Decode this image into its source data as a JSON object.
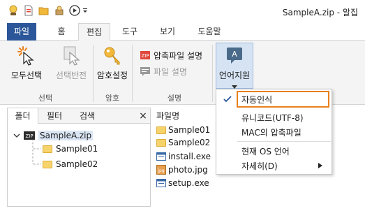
{
  "window": {
    "title": "SampleA.zip - 알집"
  },
  "quick_access": [
    "app-logo-icon",
    "new-icon",
    "open-icon",
    "extract-icon",
    "play-icon",
    "dropdown-arrow-icon"
  ],
  "menu": {
    "tabs": [
      {
        "label": "파일",
        "active": false,
        "file": true
      },
      {
        "label": "홈",
        "active": false
      },
      {
        "label": "편집",
        "active": true
      },
      {
        "label": "도구",
        "active": false
      },
      {
        "label": "보기",
        "active": false
      },
      {
        "label": "도움말",
        "active": false
      }
    ]
  },
  "ribbon": {
    "select_all": "모두선택",
    "invert_select": "선택반전",
    "group_select": "선택",
    "password": "암호설정",
    "group_password": "암호",
    "archive_comment": "압축파일 설명",
    "file_comment": "파일 설명",
    "group_comment": "설명",
    "language_support": "언어지원"
  },
  "left_panel": {
    "tabs": [
      "폴더",
      "필터",
      "검색"
    ],
    "close": "×",
    "tree": {
      "root": "SampleA.zip",
      "children": [
        "Sample01",
        "Sample02"
      ]
    }
  },
  "file_list": {
    "header": "파일명",
    "items": [
      {
        "name": "Sample01",
        "icon": "folder-icon"
      },
      {
        "name": "Sample02",
        "icon": "folder-icon"
      },
      {
        "name": "install.exe",
        "icon": "exe-icon"
      },
      {
        "name": "photo.jpg",
        "icon": "jpg-icon"
      },
      {
        "name": "setup.exe",
        "icon": "exe-icon"
      }
    ]
  },
  "language_menu": {
    "items": [
      {
        "label": "자동인식",
        "checked": true,
        "highlighted": true
      },
      {
        "label": "유니코드(UTF-8)"
      },
      {
        "label": "MAC의 압축파일"
      },
      {
        "label": "현재 OS 언어"
      },
      {
        "label": "자세히(D)",
        "submenu": true
      }
    ]
  },
  "colors": {
    "file_tab": "#2b579a",
    "highlight": "#e8801c",
    "check": "#2b579a",
    "ribbon_bg": "#f4f4f4"
  }
}
